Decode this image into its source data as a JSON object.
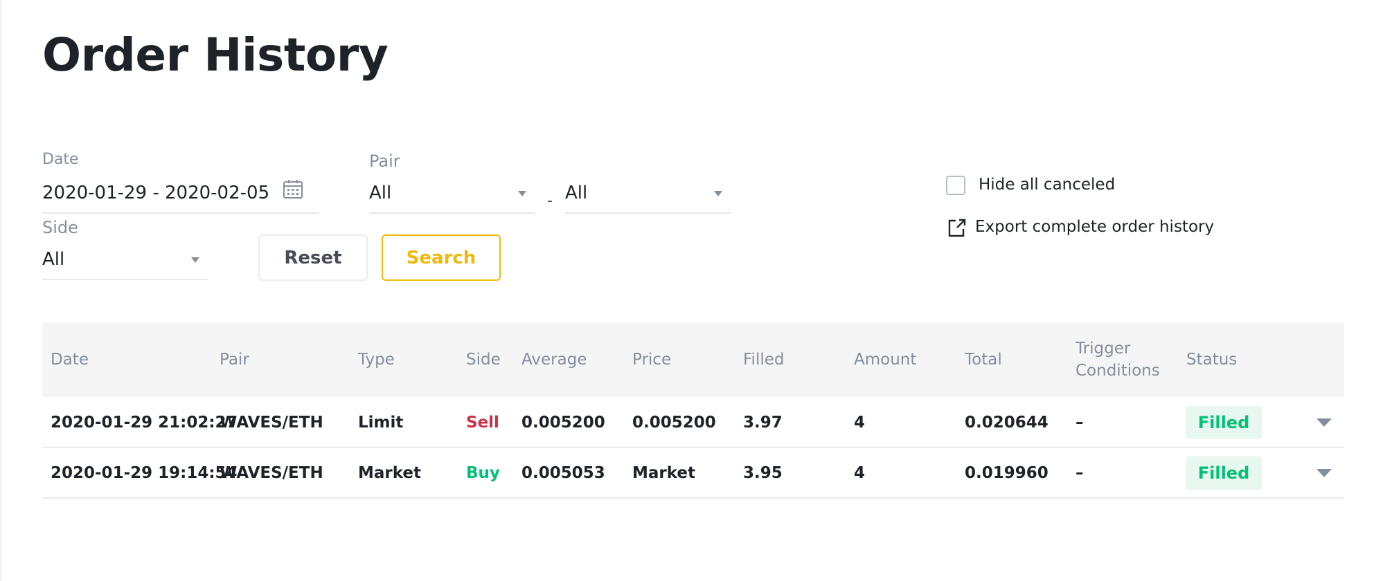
{
  "page": {
    "title": "Order History"
  },
  "filters": {
    "date": {
      "label": "Date",
      "value": "2020-01-29 - 2020-02-05",
      "icon": "calendar-icon"
    },
    "pair": {
      "label": "Pair",
      "base_value": "All",
      "separator": "-",
      "quote_value": "All"
    },
    "side": {
      "label": "Side",
      "value": "All"
    },
    "reset_label": "Reset",
    "search_label": "Search",
    "hide_canceled": {
      "label": "Hide all canceled",
      "checked": false
    },
    "export": {
      "label": "Export complete order history",
      "icon": "export-icon"
    }
  },
  "colors": {
    "accent": "#f0b90b",
    "sell": "#cf304a",
    "buy": "#02c076",
    "filled_bg": "#e8f7ef"
  },
  "table": {
    "columns": [
      "Date",
      "Pair",
      "Type",
      "Side",
      "Average",
      "Price",
      "Filled",
      "Amount",
      "Total",
      "Trigger",
      "Conditions",
      "Status"
    ],
    "rows": [
      {
        "date": "2020-01-29 21:02:27",
        "pair": "WAVES/ETH",
        "type": "Limit",
        "side": "Sell",
        "average": "0.005200",
        "price": "0.005200",
        "filled": "3.97",
        "amount": "4",
        "total": "0.020644",
        "trigger": "–",
        "status": "Filled"
      },
      {
        "date": "2020-01-29 19:14:54",
        "pair": "WAVES/ETH",
        "type": "Market",
        "side": "Buy",
        "average": "0.005053",
        "price": "Market",
        "filled": "3.95",
        "amount": "4",
        "total": "0.019960",
        "trigger": "–",
        "status": "Filled"
      }
    ]
  }
}
